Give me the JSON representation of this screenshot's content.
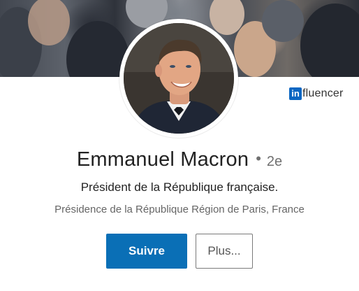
{
  "profile": {
    "name": "Emmanuel Macron",
    "connection_degree": "2e",
    "headline": "Président de la République française.",
    "location": "Présidence de la République Région de Paris, France"
  },
  "badge": {
    "icon_text": "in",
    "label": "fluencer"
  },
  "actions": {
    "follow_label": "Suivre",
    "more_label": "Plus..."
  },
  "colors": {
    "primary_button": "#0a6fb6",
    "badge_blue": "#0a66c2"
  },
  "icons": {
    "badge": "linkedin-influencer-icon"
  }
}
